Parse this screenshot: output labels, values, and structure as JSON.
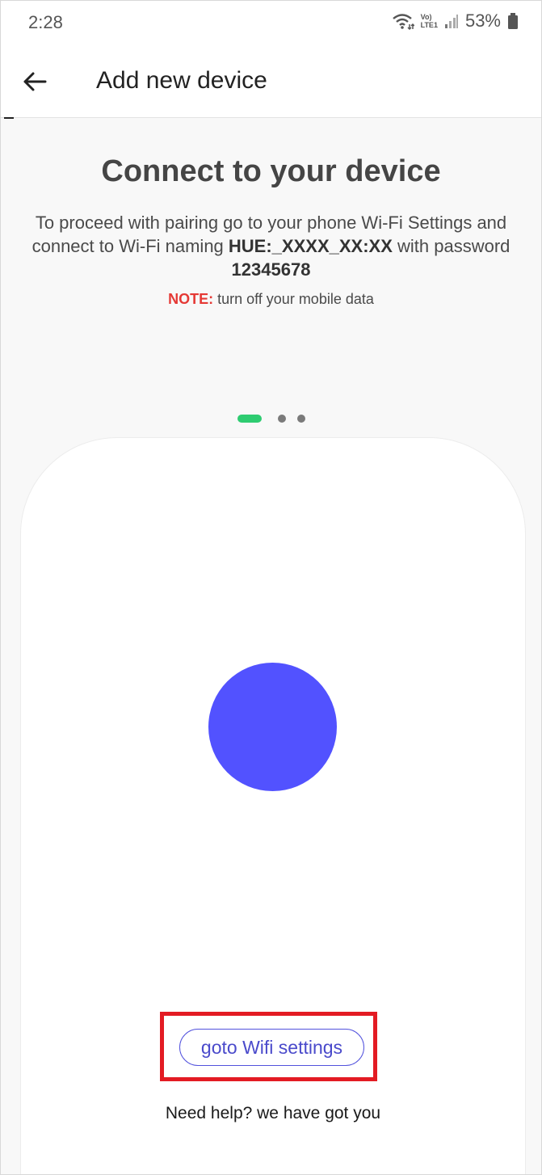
{
  "status_bar": {
    "time": "2:28",
    "battery": "53%",
    "icons": [
      "wifi-icon",
      "volte-icon",
      "signal-icon",
      "battery-icon"
    ],
    "volte_label_top": "Vo)",
    "volte_label_bottom": "LTE1"
  },
  "header": {
    "back_icon": "arrow-left-icon",
    "title": "Add new device"
  },
  "main": {
    "heading": "Connect to your device",
    "instruction_part1": "To proceed with pairing go to your phone Wi-Fi Settings and connect to Wi-Fi naming ",
    "wifi_name": "HUE:_XXXX_XX:XX",
    "instruction_part2": " with password ",
    "password": "12345678",
    "note_label": "NOTE:",
    "note_text": " turn off your mobile data",
    "pager": {
      "count": 3,
      "active_index": 0
    }
  },
  "card": {
    "button_label": "goto Wifi settings",
    "help_text": "Need help? we have got you"
  },
  "colors": {
    "accent": "#5252ff",
    "pager_active": "#2ecc71",
    "note": "#e53935",
    "highlight": "#e31b23"
  }
}
